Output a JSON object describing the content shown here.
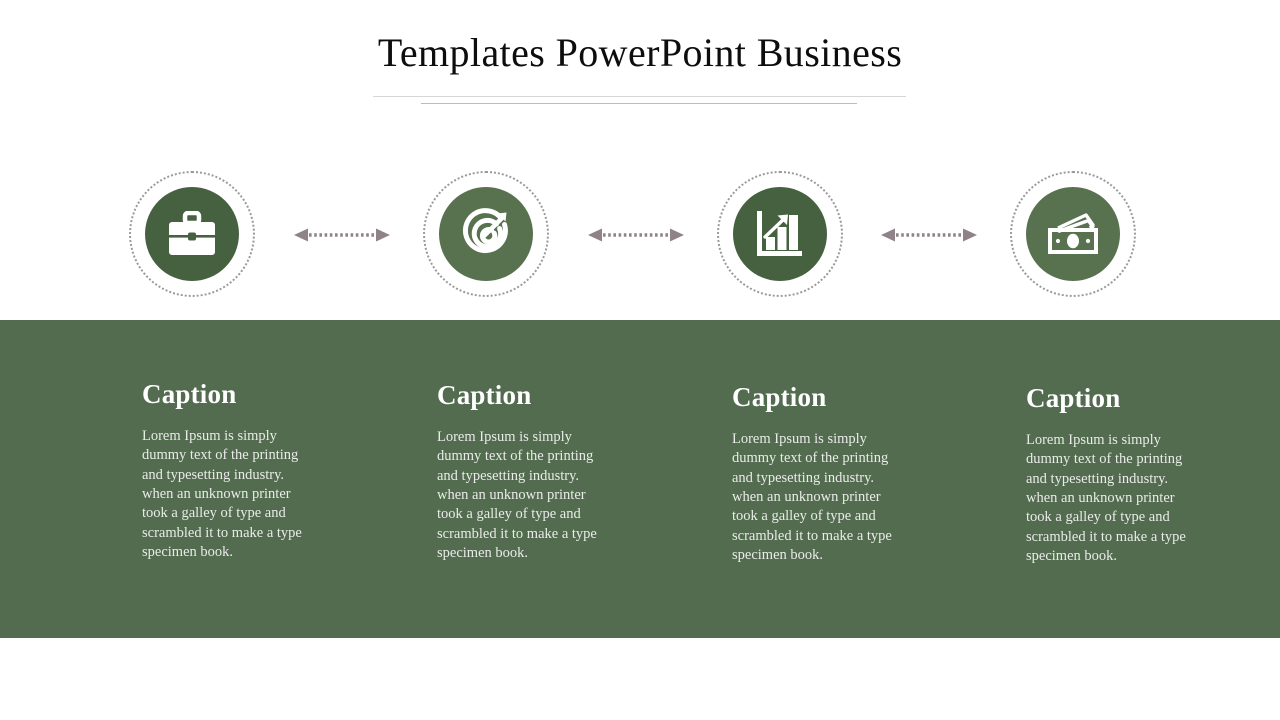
{
  "slide": {
    "title": "Templates PowerPoint Business",
    "background_color": "#ffffff",
    "band_color": "#536c4f",
    "icon_circle_dark": "#466140",
    "icon_circle_light": "#58714f",
    "ring_color": "#9a9a9a",
    "connector_color": "#8f8289",
    "rule_color": "#d4d6d8"
  },
  "nodes": [
    {
      "id": "node-1",
      "icon": "briefcase-icon",
      "circle_shade": "dark"
    },
    {
      "id": "node-2",
      "icon": "target-arrow-icon",
      "circle_shade": "light"
    },
    {
      "id": "node-3",
      "icon": "bar-chart-growth-icon",
      "circle_shade": "dark"
    },
    {
      "id": "node-4",
      "icon": "money-cash-icon",
      "circle_shade": "light"
    }
  ],
  "connectors": [
    {
      "id": "connector-1",
      "icon": "double-arrow-dotted-icon"
    },
    {
      "id": "connector-2",
      "icon": "double-arrow-dotted-icon"
    },
    {
      "id": "connector-3",
      "icon": "double-arrow-dotted-icon"
    }
  ],
  "columns": [
    {
      "heading": "Caption",
      "body": "Lorem Ipsum is simply dummy text of the printing and typesetting industry. when an unknown printer took a galley of type and scrambled it to make a type specimen book."
    },
    {
      "heading": "Caption",
      "body": "Lorem Ipsum is simply dummy text of the printing and typesetting industry. when an unknown printer took a galley of type and scrambled it to make a type specimen book."
    },
    {
      "heading": "Caption",
      "body": "Lorem Ipsum is simply dummy text of the printing and typesetting industry. when an unknown printer took a galley of type and scrambled it to make a type specimen book."
    },
    {
      "heading": "Caption",
      "body": "Lorem Ipsum is simply dummy text of the printing and typesetting industry. when an unknown printer took a galley of type and scrambled it to make a type specimen book."
    }
  ]
}
